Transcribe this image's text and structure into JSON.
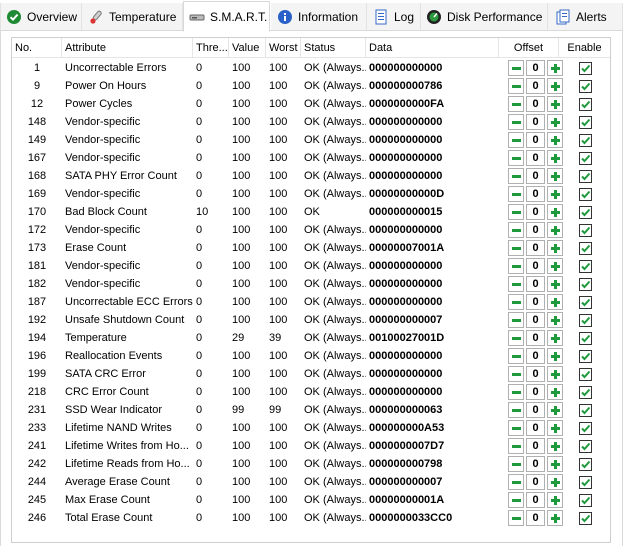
{
  "tabs": [
    {
      "key": "overview",
      "label": "Overview",
      "icon": "green-check-circle-icon"
    },
    {
      "key": "temperature",
      "label": "Temperature",
      "icon": "thermometer-icon"
    },
    {
      "key": "smart",
      "label": "S.M.A.R.T.",
      "icon": "smart-drive-icon"
    },
    {
      "key": "information",
      "label": "Information",
      "icon": "info-icon"
    },
    {
      "key": "log",
      "label": "Log",
      "icon": "log-icon"
    },
    {
      "key": "disk_performance",
      "label": "Disk Performance",
      "icon": "gauge-icon"
    },
    {
      "key": "alerts",
      "label": "Alerts",
      "icon": "alerts-icon"
    }
  ],
  "active_tab": "S.M.A.R.T.",
  "colors": {
    "accent_green": "#1e9a3c",
    "check_green": "#1e9a3c"
  },
  "table": {
    "headers": {
      "no": "No.",
      "attribute": "Attribute",
      "threshold": "Thre...",
      "value": "Value",
      "worst": "Worst",
      "status": "Status",
      "data": "Data",
      "offset": "Offset",
      "enable": "Enable"
    },
    "rows": [
      {
        "no": "1",
        "attribute": "Uncorrectable Errors",
        "threshold": "0",
        "value": "100",
        "worst": "100",
        "status": "OK (Always...",
        "data": "000000000000",
        "offset": "0",
        "enabled": true
      },
      {
        "no": "9",
        "attribute": "Power On Hours",
        "threshold": "0",
        "value": "100",
        "worst": "100",
        "status": "OK (Always...",
        "data": "000000000786",
        "offset": "0",
        "enabled": true
      },
      {
        "no": "12",
        "attribute": "Power Cycles",
        "threshold": "0",
        "value": "100",
        "worst": "100",
        "status": "OK (Always...",
        "data": "0000000000FA",
        "offset": "0",
        "enabled": true
      },
      {
        "no": "148",
        "attribute": "Vendor-specific",
        "threshold": "0",
        "value": "100",
        "worst": "100",
        "status": "OK (Always...",
        "data": "000000000000",
        "offset": "0",
        "enabled": true
      },
      {
        "no": "149",
        "attribute": "Vendor-specific",
        "threshold": "0",
        "value": "100",
        "worst": "100",
        "status": "OK (Always...",
        "data": "000000000000",
        "offset": "0",
        "enabled": true
      },
      {
        "no": "167",
        "attribute": "Vendor-specific",
        "threshold": "0",
        "value": "100",
        "worst": "100",
        "status": "OK (Always...",
        "data": "000000000000",
        "offset": "0",
        "enabled": true
      },
      {
        "no": "168",
        "attribute": "SATA PHY Error Count",
        "threshold": "0",
        "value": "100",
        "worst": "100",
        "status": "OK (Always...",
        "data": "000000000000",
        "offset": "0",
        "enabled": true
      },
      {
        "no": "169",
        "attribute": "Vendor-specific",
        "threshold": "0",
        "value": "100",
        "worst": "100",
        "status": "OK (Always...",
        "data": "00000000000D",
        "offset": "0",
        "enabled": true
      },
      {
        "no": "170",
        "attribute": "Bad Block Count",
        "threshold": "10",
        "value": "100",
        "worst": "100",
        "status": "OK",
        "data": "000000000015",
        "offset": "0",
        "enabled": true
      },
      {
        "no": "172",
        "attribute": "Vendor-specific",
        "threshold": "0",
        "value": "100",
        "worst": "100",
        "status": "OK (Always...",
        "data": "000000000000",
        "offset": "0",
        "enabled": true
      },
      {
        "no": "173",
        "attribute": "Erase Count",
        "threshold": "0",
        "value": "100",
        "worst": "100",
        "status": "OK (Always...",
        "data": "00000007001A",
        "offset": "0",
        "enabled": true
      },
      {
        "no": "181",
        "attribute": "Vendor-specific",
        "threshold": "0",
        "value": "100",
        "worst": "100",
        "status": "OK (Always...",
        "data": "000000000000",
        "offset": "0",
        "enabled": true
      },
      {
        "no": "182",
        "attribute": "Vendor-specific",
        "threshold": "0",
        "value": "100",
        "worst": "100",
        "status": "OK (Always...",
        "data": "000000000000",
        "offset": "0",
        "enabled": true
      },
      {
        "no": "187",
        "attribute": "Uncorrectable ECC Errors",
        "threshold": "0",
        "value": "100",
        "worst": "100",
        "status": "OK (Always...",
        "data": "000000000000",
        "offset": "0",
        "enabled": true
      },
      {
        "no": "192",
        "attribute": "Unsafe Shutdown Count",
        "threshold": "0",
        "value": "100",
        "worst": "100",
        "status": "OK (Always...",
        "data": "000000000007",
        "offset": "0",
        "enabled": true
      },
      {
        "no": "194",
        "attribute": "Temperature",
        "threshold": "0",
        "value": "29",
        "worst": "39",
        "status": "OK (Always...",
        "data": "00100027001D",
        "offset": "0",
        "enabled": true
      },
      {
        "no": "196",
        "attribute": "Reallocation Events",
        "threshold": "0",
        "value": "100",
        "worst": "100",
        "status": "OK (Always...",
        "data": "000000000000",
        "offset": "0",
        "enabled": true
      },
      {
        "no": "199",
        "attribute": "SATA CRC Error",
        "threshold": "0",
        "value": "100",
        "worst": "100",
        "status": "OK (Always...",
        "data": "000000000000",
        "offset": "0",
        "enabled": true
      },
      {
        "no": "218",
        "attribute": "CRC Error Count",
        "threshold": "0",
        "value": "100",
        "worst": "100",
        "status": "OK (Always...",
        "data": "000000000000",
        "offset": "0",
        "enabled": true
      },
      {
        "no": "231",
        "attribute": "SSD Wear Indicator",
        "threshold": "0",
        "value": "99",
        "worst": "99",
        "status": "OK (Always...",
        "data": "000000000063",
        "offset": "0",
        "enabled": true
      },
      {
        "no": "233",
        "attribute": "Lifetime NAND Writes",
        "threshold": "0",
        "value": "100",
        "worst": "100",
        "status": "OK (Always...",
        "data": "000000000A53",
        "offset": "0",
        "enabled": true
      },
      {
        "no": "241",
        "attribute": "Lifetime Writes from Ho...",
        "threshold": "0",
        "value": "100",
        "worst": "100",
        "status": "OK (Always...",
        "data": "0000000007D7",
        "offset": "0",
        "enabled": true
      },
      {
        "no": "242",
        "attribute": "Lifetime Reads from Ho...",
        "threshold": "0",
        "value": "100",
        "worst": "100",
        "status": "OK (Always...",
        "data": "000000000798",
        "offset": "0",
        "enabled": true
      },
      {
        "no": "244",
        "attribute": "Average Erase Count",
        "threshold": "0",
        "value": "100",
        "worst": "100",
        "status": "OK (Always...",
        "data": "000000000007",
        "offset": "0",
        "enabled": true
      },
      {
        "no": "245",
        "attribute": "Max Erase Count",
        "threshold": "0",
        "value": "100",
        "worst": "100",
        "status": "OK (Always...",
        "data": "00000000001A",
        "offset": "0",
        "enabled": true
      },
      {
        "no": "246",
        "attribute": "Total Erase Count",
        "threshold": "0",
        "value": "100",
        "worst": "100",
        "status": "OK (Always...",
        "data": "0000000033CC0",
        "offset": "0",
        "enabled": true
      }
    ]
  }
}
